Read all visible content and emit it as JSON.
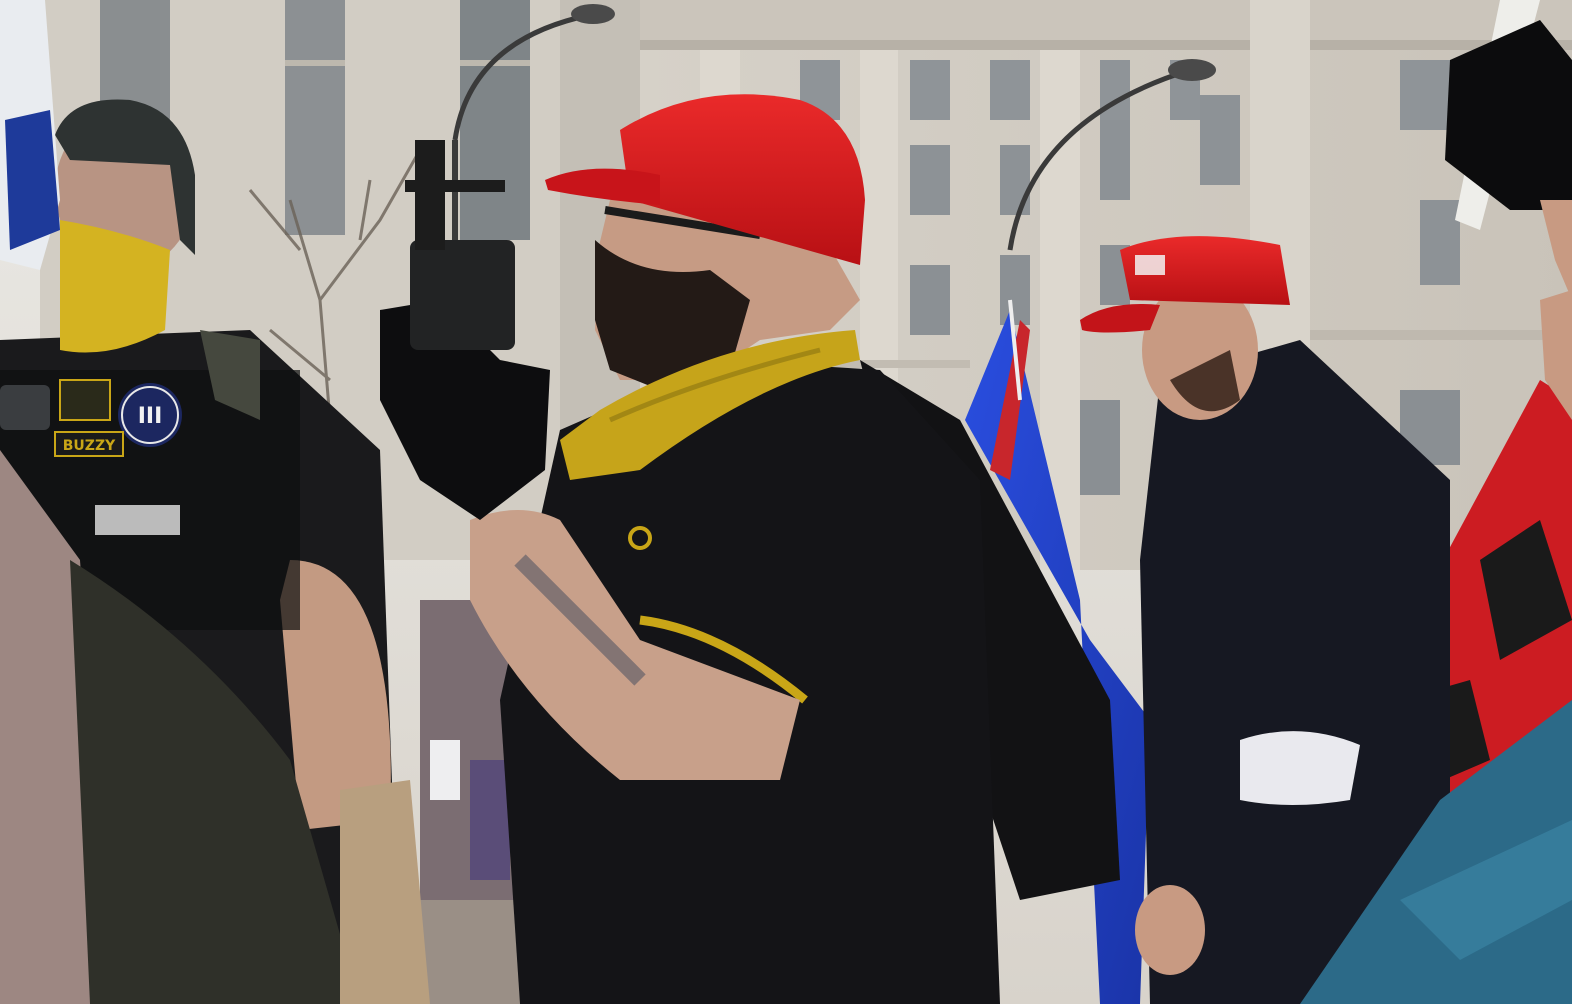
{
  "scene": {
    "kind": "photograph",
    "colors": {
      "building": "#d9d4cb",
      "building_shadow": "#b8b2a8",
      "sky": "#e4e1dc",
      "red_cap": "#e0141d",
      "black_clothing": "#121214",
      "yellow_scarf": "#c9a617",
      "blue_flag": "#1f3fc9",
      "skin": "#c9a08a"
    }
  },
  "patches": {
    "name_tag": "BUZZY",
    "roman_three": "III"
  }
}
